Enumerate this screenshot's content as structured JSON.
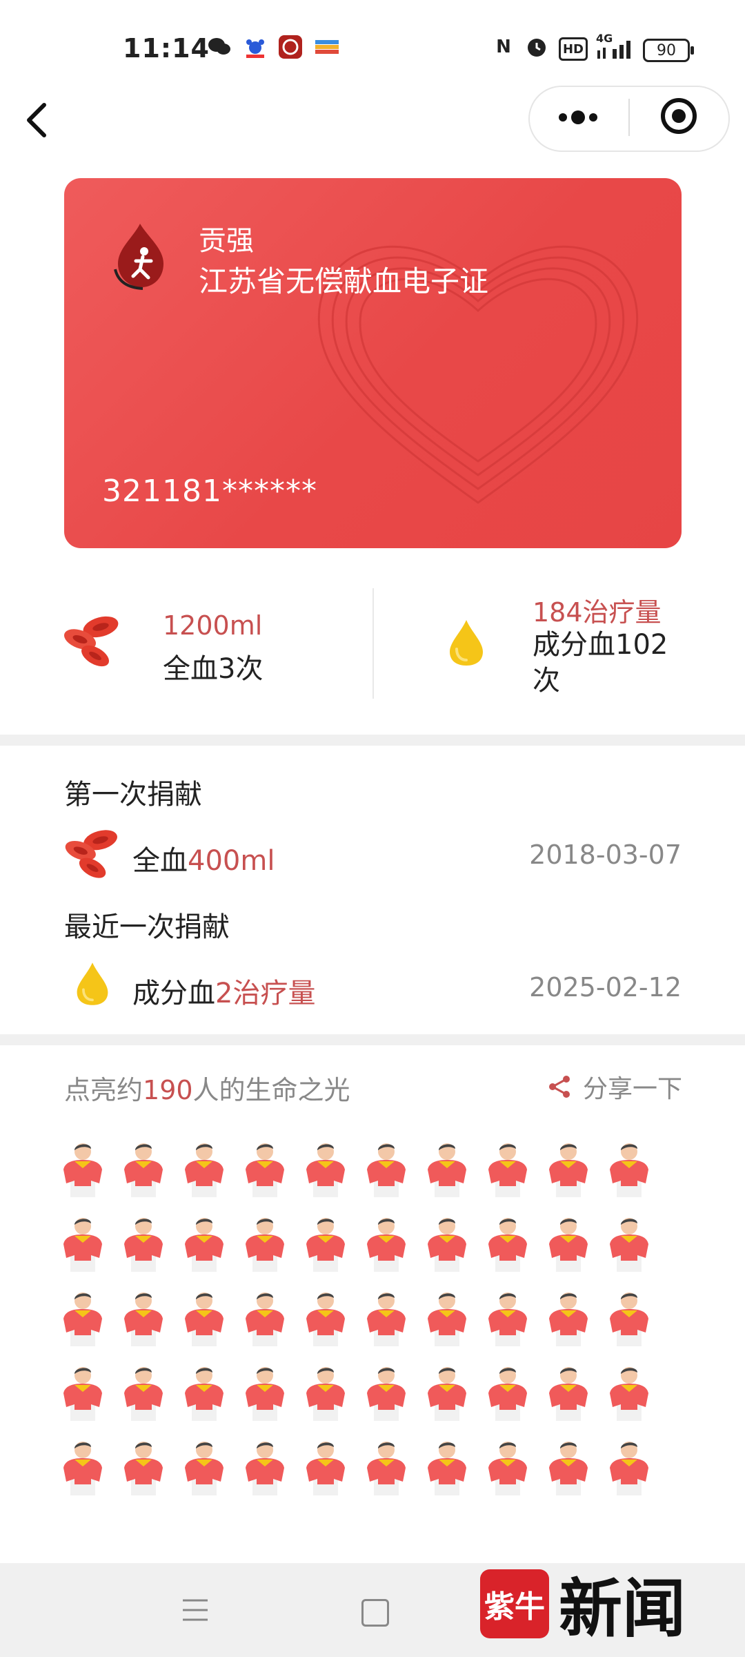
{
  "status_bar": {
    "time": "11:14",
    "battery": "90",
    "network": "4G",
    "hd": "HD",
    "nfc": "N"
  },
  "card": {
    "name": "贡强",
    "title": "江苏省无偿献血电子证",
    "id_number": "321181******"
  },
  "stats": {
    "whole_blood": {
      "amount": "1200ml",
      "label": "全血3次"
    },
    "component": {
      "amount": "184治疗量",
      "label": "成分血102次"
    }
  },
  "donations": {
    "first_title": "第一次捐献",
    "first": {
      "type": "全血",
      "amount": "400ml",
      "date": "2018-03-07"
    },
    "latest_title": "最近一次捐献",
    "latest": {
      "type": "成分血",
      "amount": "2治疗量",
      "date": "2025-02-12"
    }
  },
  "lights": {
    "prefix": "点亮约",
    "count": "190",
    "suffix": "人的生命之光",
    "share_label": "分享一下",
    "people_rows": 5,
    "people_cols": 10
  },
  "watermark": {
    "logo": "紫牛",
    "text": "新闻"
  },
  "icons": [
    "back-icon",
    "more-icon",
    "close-icon",
    "blood-cells-icon",
    "plasma-drop-icon",
    "share-icon",
    "person-icon",
    "menu-icon",
    "home-icon"
  ],
  "colors": {
    "card_red": "#e84848",
    "accent": "#c75050",
    "drop_yellow": "#f5c518"
  }
}
